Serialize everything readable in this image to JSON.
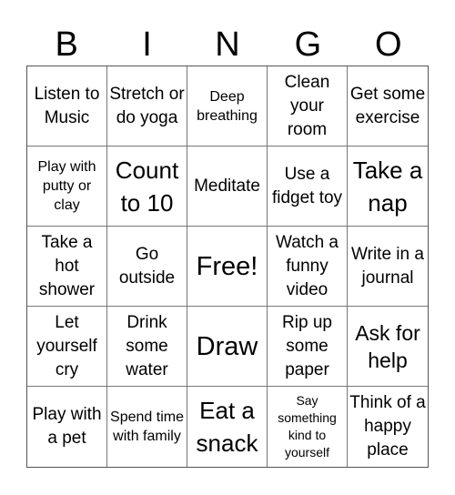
{
  "header": {
    "letters": [
      "B",
      "I",
      "N",
      "G",
      "O"
    ]
  },
  "cells": [
    {
      "text": "Listen to Music",
      "size": "md"
    },
    {
      "text": "Stretch or do yoga",
      "size": "md"
    },
    {
      "text": "Deep breathing",
      "size": "sm2"
    },
    {
      "text": "Clean your room",
      "size": "md"
    },
    {
      "text": "Get some exercise",
      "size": "md"
    },
    {
      "text": "Play with putty or clay",
      "size": "sm2"
    },
    {
      "text": "Count to 10",
      "size": "lg"
    },
    {
      "text": "Meditate",
      "size": "md"
    },
    {
      "text": "Use a fidget toy",
      "size": "md"
    },
    {
      "text": "Take a nap",
      "size": "lg"
    },
    {
      "text": "Take a hot shower",
      "size": "md"
    },
    {
      "text": "Go outside",
      "size": "md"
    },
    {
      "text": "Free!",
      "size": "xl"
    },
    {
      "text": "Watch a funny video",
      "size": "md"
    },
    {
      "text": "Write in a journal",
      "size": "md"
    },
    {
      "text": "Let yourself cry",
      "size": "md"
    },
    {
      "text": "Drink some water",
      "size": "md"
    },
    {
      "text": "Draw",
      "size": "xl"
    },
    {
      "text": "Rip up some paper",
      "size": "md"
    },
    {
      "text": "Ask for help",
      "size": "lg2"
    },
    {
      "text": "Play with a pet",
      "size": "md"
    },
    {
      "text": "Spend time with family",
      "size": "sm2"
    },
    {
      "text": "Eat a snack",
      "size": "lg"
    },
    {
      "text": "Say something kind to yourself",
      "size": "sm"
    },
    {
      "text": "Think of a happy place",
      "size": "md"
    }
  ]
}
